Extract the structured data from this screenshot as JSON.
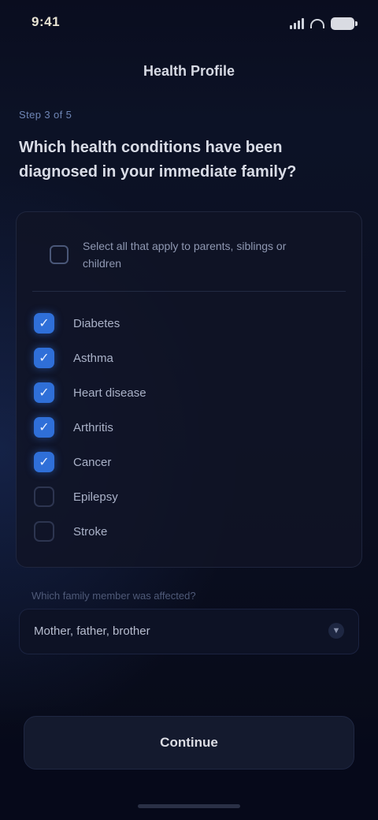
{
  "status_bar": {
    "time": "9:41"
  },
  "nav": {
    "title": "Health Profile"
  },
  "section": {
    "label": "Step 3 of 5",
    "question": "Which health conditions have been diagnosed in your immediate family?"
  },
  "card": {
    "header_text": "Select all that apply to parents, siblings or children"
  },
  "options": [
    {
      "label": "Diabetes",
      "checked": true
    },
    {
      "label": "Asthma",
      "checked": true
    },
    {
      "label": "Heart disease",
      "checked": true
    },
    {
      "label": "Arthritis",
      "checked": true
    },
    {
      "label": "Cancer",
      "checked": true
    },
    {
      "label": "Epilepsy",
      "checked": false
    },
    {
      "label": "Stroke",
      "checked": false
    }
  ],
  "relation_field": {
    "hint": "Which family member was affected?",
    "value": "Mother, father, brother"
  },
  "footer": {
    "button_label": "Continue"
  },
  "colors": {
    "accent": "#2f6fd8",
    "background": "#070a17"
  },
  "icons": {
    "checked": "checkmark-icon",
    "dropdown": "chevron-down-icon"
  }
}
